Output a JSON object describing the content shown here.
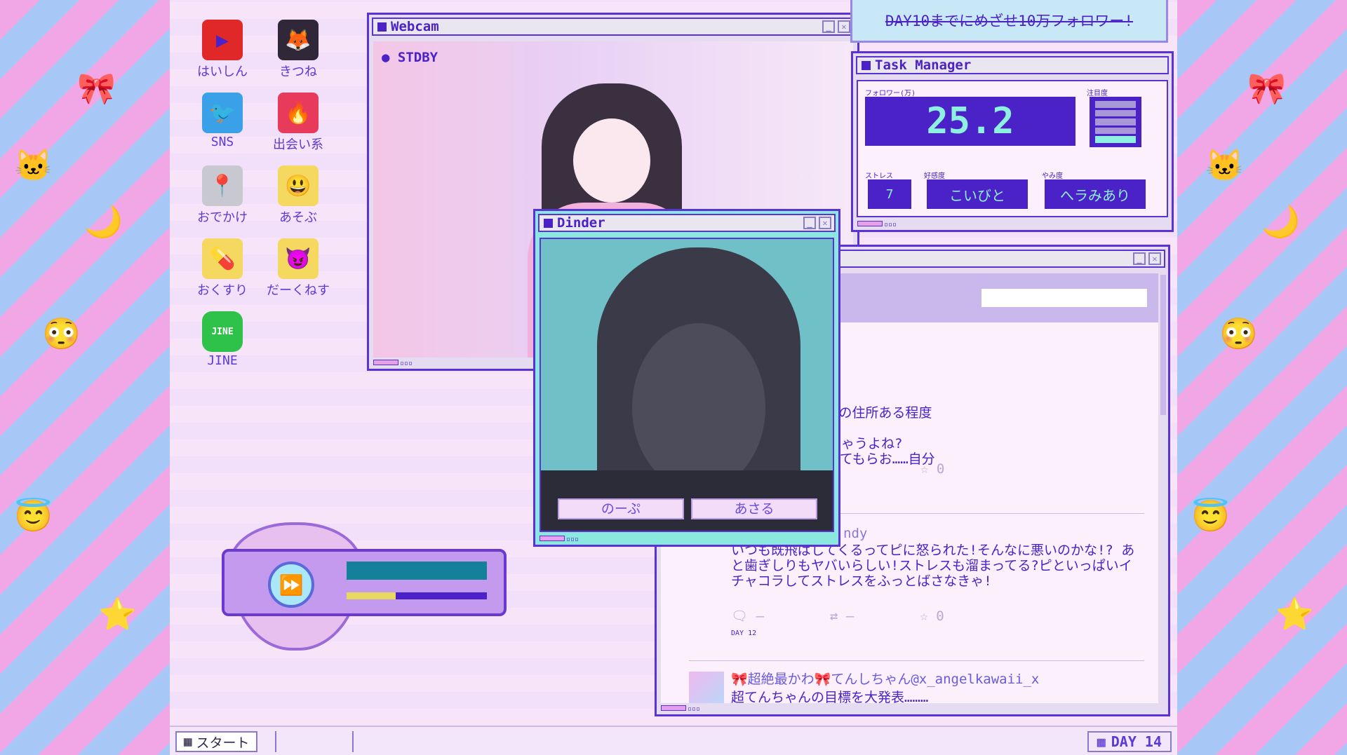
{
  "desktop": {
    "icons": [
      {
        "label": "はいしん",
        "icon": "video-play-icon",
        "glyph": "▶",
        "color": "#e02828"
      },
      {
        "label": "きつね",
        "icon": "fox-mask-icon",
        "glyph": "🦊",
        "color": "#302838"
      },
      {
        "label": "SNS",
        "icon": "bird-icon",
        "glyph": "🐦",
        "color": "#3aa0e8"
      },
      {
        "label": "出会い系",
        "icon": "fire-icon",
        "glyph": "🔥",
        "color": "#e83a5a"
      },
      {
        "label": "おでかけ",
        "icon": "map-pin-icon",
        "glyph": "📍",
        "color": "#c8c8d0"
      },
      {
        "label": "あそぶ",
        "icon": "smiley-folder-icon",
        "glyph": "😃",
        "color": "#f4d860"
      },
      {
        "label": "おくすり",
        "icon": "pill-folder-icon",
        "glyph": "💊",
        "color": "#f4d860"
      },
      {
        "label": "だーくねす",
        "icon": "devil-folder-icon",
        "glyph": "😈",
        "color": "#f4d860"
      },
      {
        "label": "JINE",
        "icon": "chat-app-icon",
        "glyph": "JINE",
        "color": "#2ec24a"
      }
    ]
  },
  "webcam": {
    "title": "Webcam",
    "status": "STDBY"
  },
  "goal": {
    "text": "DAY10までにめざせ10万フォロワー!"
  },
  "task_manager": {
    "title": "Task Manager",
    "followers_label": "フォロワー(万)",
    "followers": "25.2",
    "attention_label": "注目度",
    "attention_level": 1,
    "attention_max": 5,
    "stress_label": "ストレス",
    "stress": "7",
    "affection_label": "好感度",
    "affection": "こいびと",
    "darkness_label": "やみ度",
    "darkness": "へラみあり"
  },
  "dinder": {
    "title": "Dinder",
    "buttons": {
      "pass": "のーぷ",
      "like": "あさる"
    }
  },
  "sns": {
    "posts": [
      {
        "text": "な〜😱 スレとかで、わたしの住所ある程度\nいな〜\nぜったい今の人気も終わっちゃうよね?\nスレの様子こっそり見に行ってもらお……自分",
        "likes": "0",
        "retweets": "—"
      },
      {
        "user": "ndy",
        "text": "いつも既飛ばしてくるってピに怒られた!そんなに悪いのかな!?\nあと歯ぎしりもヤバいらしい!ストレスも溜まってる?ピといっぱいイチャコラしてストレスをふっとばさなきゃ!",
        "replies": "—",
        "retweets": "—",
        "likes": "0",
        "day": "DAY 12"
      },
      {
        "user": "🎀超絶最かわ🎀てんしちゃん@x_angelkawaii_x",
        "text": "超てんちゃんの目標を大発表………"
      }
    ]
  },
  "player": {
    "progress": 0.35
  },
  "taskbar": {
    "start": "スタート",
    "day": "DAY 14"
  },
  "colors": {
    "accent": "#4a22c8",
    "mint": "#8df0e0",
    "pink": "#f1a6e6"
  }
}
